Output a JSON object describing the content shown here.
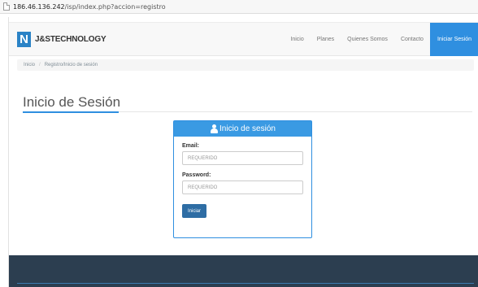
{
  "browser": {
    "url_host": "186.46.136.242",
    "url_path": "/isp/index.php?accion=registro"
  },
  "navbar": {
    "logo_letter": "N",
    "brand": "J&STECHNOLOGY",
    "links": [
      "Inicio",
      "Planes",
      "Quienes Somos",
      "Contacto"
    ],
    "active_link": "Iniciar Sesión"
  },
  "breadcrumb": {
    "home": "Inicio",
    "current": "Registro/Inicio de sesión"
  },
  "page": {
    "title": "Inicio de Sesión"
  },
  "login": {
    "heading": "Inicio de sesión",
    "email_label": "Email:",
    "email_placeholder": "REQUERIDO",
    "password_label": "Password:",
    "password_placeholder": "REQUERIDO",
    "submit_label": "Iniciar"
  },
  "colors": {
    "accent": "#2f8fe0",
    "footer": "#2c3e50",
    "button": "#2e6da4"
  }
}
